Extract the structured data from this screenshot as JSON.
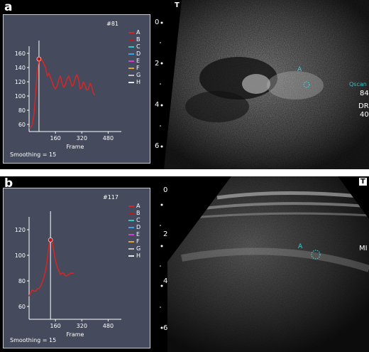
{
  "panels": [
    {
      "letter": "a",
      "frame_id": "#81",
      "smoothing": "Smoothing = 15",
      "legend": [
        "A",
        "B",
        "C",
        "D",
        "E",
        "F",
        "G",
        "H"
      ],
      "legend_colors": [
        "#d02828",
        "#b02020",
        "#33c6c6",
        "#3aa0e8",
        "#d040d0",
        "#e0a040",
        "#c0c0c0",
        "#e8e8e8"
      ],
      "ticks": {
        "y": [
          "60",
          "80",
          "100",
          "120",
          "140",
          "160"
        ],
        "x": [
          "160",
          "320",
          "480"
        ]
      },
      "xlabel": "Frame",
      "overlay": {
        "label_a": "A",
        "label_qscan": "Qscan",
        "val1": "84",
        "label_dr": "DR",
        "val2": "40",
        "t_icon": "T"
      },
      "depth_marks": [
        "0",
        "2",
        "4",
        "6"
      ]
    },
    {
      "letter": "b",
      "frame_id": "#117",
      "smoothing": "Smoothing = 15",
      "legend": [
        "A",
        "B",
        "C",
        "D",
        "E",
        "F",
        "G",
        "H"
      ],
      "legend_colors": [
        "#d02828",
        "#b02020",
        "#33c6c6",
        "#3aa0e8",
        "#d040d0",
        "#e0a040",
        "#c0c0c0",
        "#e8e8e8"
      ],
      "ticks": {
        "y": [
          "60",
          "80",
          "100",
          "120"
        ],
        "x": [
          "160",
          "320",
          "480"
        ]
      },
      "xlabel": "Frame",
      "overlay": {
        "label_a": "A",
        "label_mi": "MI",
        "t_icon": "T"
      },
      "depth_marks": [
        "0",
        "2",
        "4",
        "6"
      ]
    }
  ],
  "chart_data": [
    {
      "type": "line",
      "title": "",
      "xlabel": "Frame",
      "ylabel": "",
      "xlim": [
        0,
        560
      ],
      "ylim": [
        50,
        170
      ],
      "series": [
        {
          "name": "A",
          "color": "#d02828",
          "x": [
            0,
            10,
            20,
            30,
            40,
            50,
            60,
            70,
            80,
            90,
            100,
            110,
            120,
            130,
            140,
            150,
            160,
            170,
            180,
            190,
            200,
            210,
            220,
            230,
            240,
            250,
            260,
            270,
            280,
            290,
            300,
            310,
            320,
            330,
            340,
            350,
            360,
            370,
            380,
            390,
            400
          ],
          "values": [
            55,
            56,
            60,
            75,
            105,
            135,
            152,
            152,
            150,
            145,
            140,
            128,
            132,
            126,
            120,
            113,
            110,
            114,
            123,
            128,
            118,
            112,
            116,
            124,
            128,
            122,
            114,
            116,
            125,
            130,
            124,
            110,
            112,
            120,
            115,
            108,
            110,
            118,
            113,
            104,
            101
          ]
        }
      ],
      "peak": {
        "x": 60,
        "y": 152
      },
      "marker_x": 60
    },
    {
      "type": "line",
      "title": "",
      "xlabel": "Frame",
      "ylabel": "",
      "xlim": [
        0,
        560
      ],
      "ylim": [
        50,
        130
      ],
      "series": [
        {
          "name": "A",
          "color": "#d02828",
          "x": [
            0,
            10,
            20,
            30,
            40,
            50,
            60,
            70,
            80,
            90,
            100,
            110,
            120,
            130,
            140,
            150,
            160,
            170,
            180,
            190,
            200,
            210,
            220,
            230,
            240,
            250,
            260,
            270
          ],
          "values": [
            68,
            71,
            73,
            72,
            72,
            74,
            74,
            76,
            79,
            83,
            88,
            96,
            108,
            112,
            111,
            103,
            96,
            91,
            88,
            85,
            86,
            86,
            84,
            84,
            85,
            86,
            86,
            86
          ]
        }
      ],
      "peak": {
        "x": 130,
        "y": 112
      },
      "marker_x": 130
    }
  ]
}
